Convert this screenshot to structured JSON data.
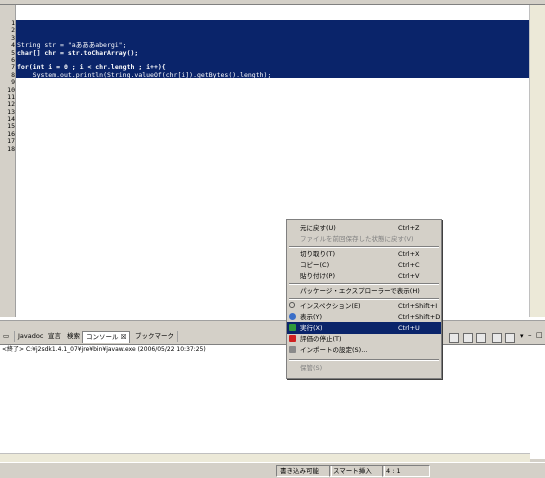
{
  "editor": {
    "line_numbers": [
      "1",
      "2",
      "3",
      "4",
      "5",
      "6",
      "7",
      "8",
      "9",
      "10",
      "11",
      "12",
      "13",
      "14",
      "15",
      "16",
      "17",
      "18"
    ],
    "code_lines": [
      "",
      "",
      "",
      "String str = \"aあああabergi\";",
      "char[] chr = str.toCharArray();",
      "",
      "for(int i = 0 ; i < chr.length ; i++){",
      "    System.out.println(String.valueOf(chr[i]).getBytes().length);",
      "}",
      "",
      "",
      "",
      "",
      "",
      "",
      "",
      "",
      ""
    ]
  },
  "bottom_tabs": [
    {
      "label": "Javadoc"
    },
    {
      "label": "宣言"
    },
    {
      "label": "検索"
    },
    {
      "label": "コンソール ☒"
    },
    {
      "label": "ブックマーク"
    }
  ],
  "console": {
    "header": "<終了> C:¥j2sdk1.4.1_07¥jre¥bin¥javaw.exe (2006/05/22 10:37:25)"
  },
  "status": {
    "writable": "書き込み可能",
    "insert_mode": "スマート挿入",
    "position": "4 : 1"
  },
  "context_menu": {
    "items": [
      {
        "label": "元に戻す(U)",
        "shortcut": "Ctrl+Z",
        "disabled": false
      },
      {
        "label": "ファイルを前回保存した状態に戻す(V)",
        "shortcut": "",
        "disabled": true
      },
      {
        "label": "切り取り(T)",
        "shortcut": "Ctrl+X",
        "disabled": false
      },
      {
        "label": "コピー(C)",
        "shortcut": "Ctrl+C",
        "disabled": false
      },
      {
        "label": "貼り付け(P)",
        "shortcut": "Ctrl+V",
        "disabled": false
      },
      {
        "label": "パッケージ・エクスプローラーで表示(H)",
        "shortcut": "",
        "disabled": false
      },
      {
        "label": "インスペクション(E)",
        "shortcut": "Ctrl+Shift+I",
        "disabled": false
      },
      {
        "label": "表示(Y)",
        "shortcut": "Ctrl+Shift+D",
        "disabled": false
      },
      {
        "label": "実行(X)",
        "shortcut": "Ctrl+U",
        "disabled": false
      },
      {
        "label": "評価の停止(T)",
        "shortcut": "",
        "disabled": false
      },
      {
        "label": "インポートの設定(S)...",
        "shortcut": "",
        "disabled": false
      },
      {
        "label": "保管(S)",
        "shortcut": "",
        "disabled": true
      }
    ],
    "highlighted_index": 8,
    "colors": {
      "highlight": "#0a246a"
    }
  }
}
